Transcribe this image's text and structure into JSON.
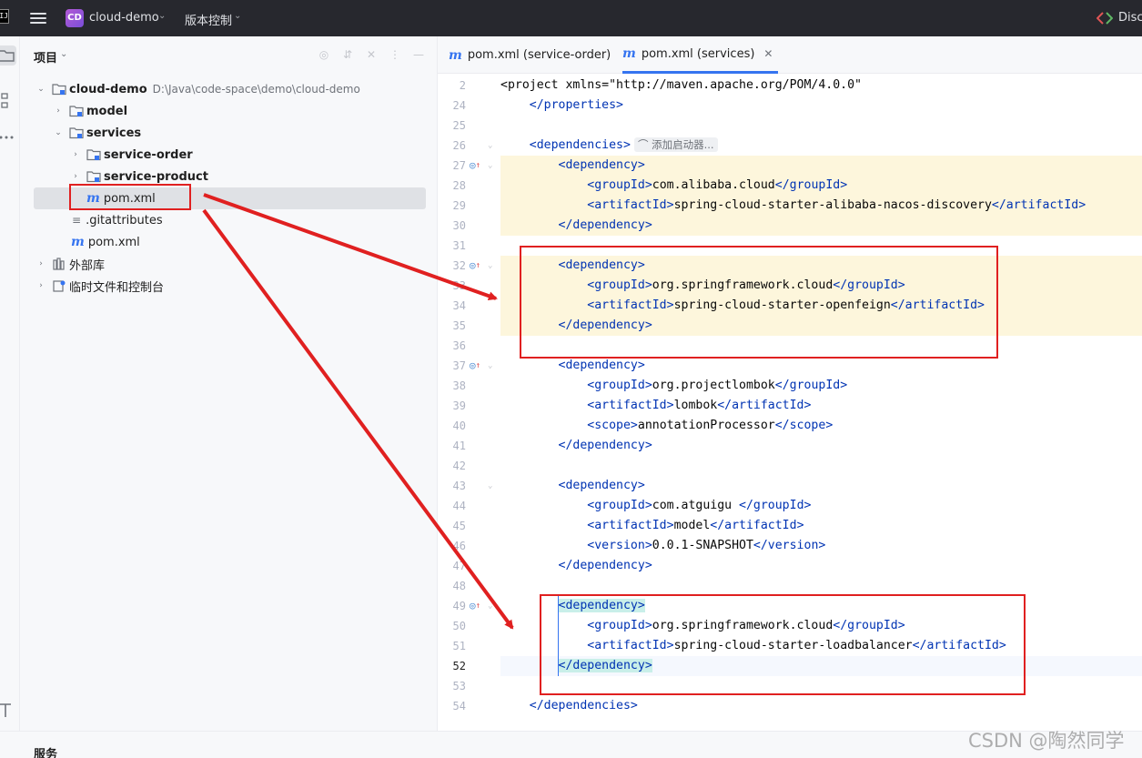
{
  "titlebar": {
    "logo_text": "IJ",
    "project_badge": "CD",
    "project_name": "cloud-demo",
    "vcs_label": "版本控制",
    "right_text": "Disc"
  },
  "project_panel": {
    "title": "项目",
    "tree": [
      {
        "label": "cloud-demo",
        "path": "D:\\Java\\code-space\\demo\\cloud-demo"
      },
      {
        "label": "model"
      },
      {
        "label": "services"
      },
      {
        "label": "service-order"
      },
      {
        "label": "service-product"
      },
      {
        "label": "pom.xml"
      },
      {
        "label": ".gitattributes"
      },
      {
        "label": "pom.xml"
      },
      {
        "label": "外部库"
      },
      {
        "label": "临时文件和控制台"
      }
    ]
  },
  "tabs": [
    {
      "label": "pom.xml (service-order)"
    },
    {
      "label": "pom.xml (services)"
    }
  ],
  "editor": {
    "inlay_hint": "添加启动器...",
    "lines": [
      {
        "n": "2",
        "code": "<project xmlns=\"http://maven.apache.org/POM/4.0.0\""
      },
      {
        "n": "24",
        "code": "    </properties>"
      },
      {
        "n": "25",
        "code": ""
      },
      {
        "n": "26",
        "code": "    <dependencies>"
      },
      {
        "n": "27",
        "code": "        <dependency>"
      },
      {
        "n": "28",
        "code": "            <groupId>com.alibaba.cloud</groupId>"
      },
      {
        "n": "29",
        "code": "            <artifactId>spring-cloud-starter-alibaba-nacos-discovery</artifactId>"
      },
      {
        "n": "30",
        "code": "        </dependency>"
      },
      {
        "n": "31",
        "code": ""
      },
      {
        "n": "32",
        "code": "        <dependency>"
      },
      {
        "n": "33",
        "code": "            <groupId>org.springframework.cloud</groupId>"
      },
      {
        "n": "34",
        "code": "            <artifactId>spring-cloud-starter-openfeign</artifactId>"
      },
      {
        "n": "35",
        "code": "        </dependency>"
      },
      {
        "n": "36",
        "code": ""
      },
      {
        "n": "37",
        "code": "        <dependency>"
      },
      {
        "n": "38",
        "code": "            <groupId>org.projectlombok</groupId>"
      },
      {
        "n": "39",
        "code": "            <artifactId>lombok</artifactId>"
      },
      {
        "n": "40",
        "code": "            <scope>annotationProcessor</scope>"
      },
      {
        "n": "41",
        "code": "        </dependency>"
      },
      {
        "n": "42",
        "code": ""
      },
      {
        "n": "43",
        "code": "        <dependency>"
      },
      {
        "n": "44",
        "code": "            <groupId>com.atguigu </groupId>"
      },
      {
        "n": "45",
        "code": "            <artifactId>model</artifactId>"
      },
      {
        "n": "46",
        "code": "            <version>0.0.1-SNAPSHOT</version>"
      },
      {
        "n": "47",
        "code": "        </dependency>"
      },
      {
        "n": "48",
        "code": ""
      },
      {
        "n": "49",
        "code": "        <dependency>"
      },
      {
        "n": "50",
        "code": "            <groupId>org.springframework.cloud</groupId>"
      },
      {
        "n": "51",
        "code": "            <artifactId>spring-cloud-starter-loadbalancer</artifactId>"
      },
      {
        "n": "52",
        "code": "        </dependency>"
      },
      {
        "n": "53",
        "code": ""
      },
      {
        "n": "54",
        "code": "    </dependencies>"
      }
    ]
  },
  "bottom": {
    "services_label": "服务"
  },
  "watermark": "CSDN @陶然同学",
  "colors": {
    "accent": "#3574f0",
    "annotation_red": "#e02020",
    "highlight_yellow": "#fdf6dc",
    "tag_blue": "#0033b3",
    "string_green": "#067d17"
  }
}
